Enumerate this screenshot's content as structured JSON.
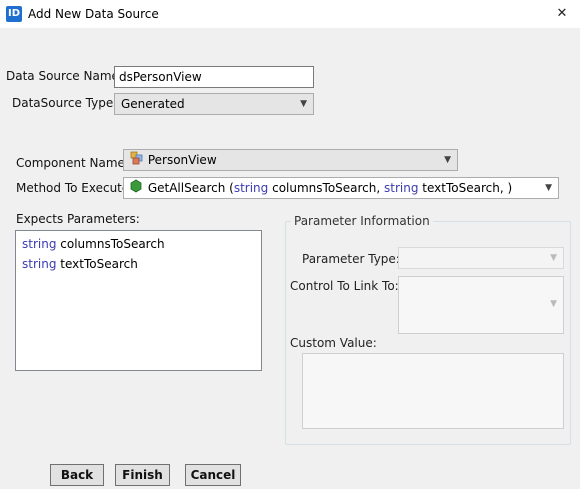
{
  "window": {
    "icon_text": "ID",
    "title": "Add New Data Source",
    "close_glyph": "✕"
  },
  "form": {
    "data_source_name_label": "Data Source Name:",
    "data_source_name_value": "dsPersonView",
    "datasource_type_label": "DataSource Type:",
    "datasource_type_value": "Generated",
    "component_name_label": "Component Name:",
    "component_name_value": "PersonView",
    "method_label": "Method To Execute",
    "method": {
      "name": "GetAllSearch (",
      "kw1": "string",
      "p1": " columnsToSearch, ",
      "kw2": "string",
      "p2": " textToSearch, )"
    }
  },
  "expects_parameters": {
    "label": "Expects Parameters:",
    "items": [
      {
        "type": "string",
        "name": " columnsToSearch"
      },
      {
        "type": "string",
        "name": " textToSearch"
      }
    ]
  },
  "parameter_information": {
    "title": "Parameter Information",
    "parameter_type_label": "Parameter Type:",
    "control_link_label": "Control To Link To:",
    "custom_value_label": "Custom Value:"
  },
  "buttons": {
    "back": "Back",
    "finish": "Finish",
    "cancel": "Cancel"
  },
  "icons": {
    "component": "component-icon",
    "method": "method-icon",
    "chevron": "chevron-down-icon"
  },
  "colors": {
    "keyword": "#3b3bb3",
    "method_icon": "#3a9a3a"
  }
}
